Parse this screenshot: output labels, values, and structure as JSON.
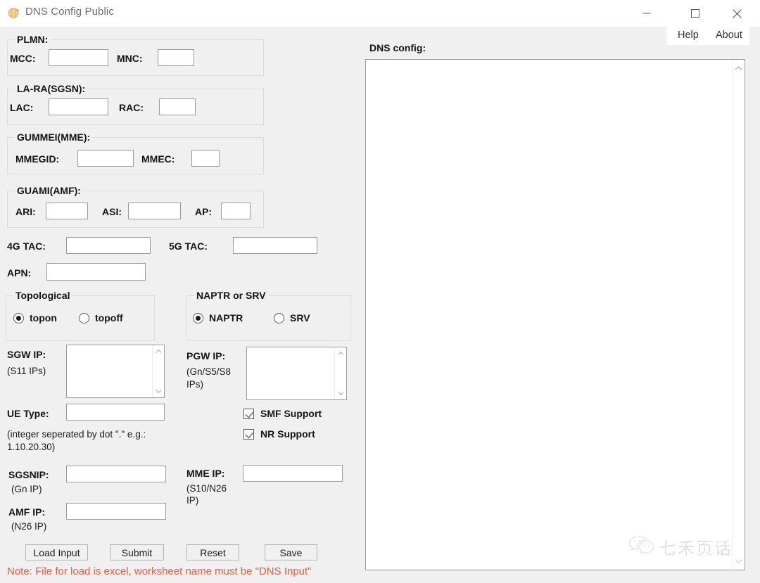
{
  "window": {
    "title": "DNS Config Public",
    "icon": "app-globe-icon",
    "minimize": "–",
    "maximize": "□",
    "close": "✕"
  },
  "menu": {
    "help": "Help",
    "about": "About"
  },
  "groups": {
    "plmn": {
      "title": "PLMN:",
      "fields": [
        {
          "label": "MCC:",
          "value": ""
        },
        {
          "label": "MNC:",
          "value": ""
        }
      ]
    },
    "lara": {
      "title": "LA-RA(SGSN):",
      "fields": [
        {
          "label": "LAC:",
          "value": ""
        },
        {
          "label": "RAC:",
          "value": ""
        }
      ]
    },
    "gummei": {
      "title": "GUMMEI(MME):",
      "fields": [
        {
          "label": "MMEGID:",
          "value": ""
        },
        {
          "label": "MMEC:",
          "value": ""
        }
      ]
    },
    "guami": {
      "title": "GUAMI(AMF):",
      "fields": [
        {
          "label": "ARI:",
          "value": ""
        },
        {
          "label": "ASI:",
          "value": ""
        },
        {
          "label": "AP:",
          "value": ""
        }
      ]
    },
    "topological": {
      "title": "Topological",
      "options": [
        {
          "label": "topon",
          "selected": true
        },
        {
          "label": "topoff",
          "selected": false
        }
      ]
    },
    "naptr": {
      "title": "NAPTR or SRV",
      "options": [
        {
          "label": "NAPTR",
          "selected": true
        },
        {
          "label": "SRV",
          "selected": false
        }
      ]
    }
  },
  "fields": {
    "tac4g": {
      "label": "4G TAC:",
      "value": ""
    },
    "tac5g": {
      "label": "5G TAC:",
      "value": ""
    },
    "apn": {
      "label": "APN:",
      "value": ""
    },
    "sgw_ip": {
      "label": "SGW IP:",
      "sublabel": "(S11 IPs)",
      "value": ""
    },
    "pgw_ip": {
      "label": "PGW IP:",
      "sublabel_line1": "(Gn/S5/S8",
      "sublabel_line2": "IPs)",
      "value": ""
    },
    "ue_type": {
      "label": "UE Type:",
      "value": ""
    },
    "ue_type_hint_line1": "(integer seperated by dot \".\" e.g.:",
    "ue_type_hint_line2": "1.10.20.30)",
    "sgsnip": {
      "label": "SGSNIP:",
      "sublabel": "(Gn IP)",
      "value": ""
    },
    "mme_ip": {
      "label": "MME IP:",
      "sublabel_line1": "(S10/N26",
      "sublabel_line2": "IP)",
      "value": ""
    },
    "amf_ip": {
      "label": "AMF IP:",
      "sublabel": "(N26 IP)",
      "value": ""
    }
  },
  "checkboxes": [
    {
      "label": "SMF Support",
      "checked": true
    },
    {
      "label": "NR Support",
      "checked": true
    }
  ],
  "buttons": {
    "load_input": "Load Input",
    "submit": "Submit",
    "reset": "Reset",
    "save": "Save"
  },
  "note": "Note: File for load is excel, worksheet name must be \"DNS Input\"",
  "dns_panel": {
    "label": "DNS config:",
    "content": ""
  },
  "watermark": {
    "text": "七禾页话",
    "icon": "wechat-icon"
  },
  "colors": {
    "window_bg": "#f0f0f0",
    "titlebar_bg": "#ffffff",
    "note_red": "#f4573c",
    "field_border": "#9a9a9a",
    "group_border": "#dcdcdc"
  }
}
